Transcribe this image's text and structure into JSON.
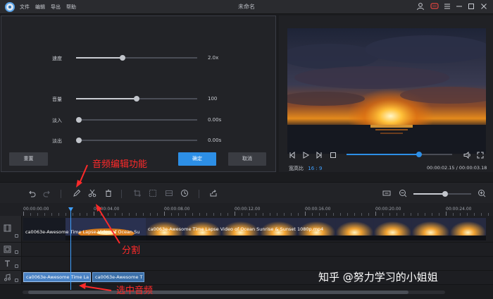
{
  "app": {
    "window_title": "未命名",
    "menu": [
      "文件",
      "编辑",
      "导出",
      "帮助"
    ]
  },
  "editor": {
    "rows": [
      {
        "label": "速度",
        "value": "2.0x",
        "level": 0.38
      },
      {
        "label": "音量",
        "value": "100",
        "level": 0.5
      },
      {
        "label": "淡入",
        "value": "0.00s",
        "level": 0
      },
      {
        "label": "淡出",
        "value": "0.00s",
        "level": 0
      }
    ],
    "reset_label": "重置",
    "confirm_label": "确定",
    "cancel_label": "取消"
  },
  "preview": {
    "aspect_label": "宽高比",
    "aspect_value": "16 : 9",
    "time": "00:00:02.15 / 00:00:03.18",
    "progress": 0.69
  },
  "timeline": {
    "ruler": [
      "00:00:00.00",
      "00:00:04.00",
      "00:00:08.00",
      "00:00:12.00",
      "00:00:16.00",
      "00:00:20.00",
      "00:00:24.00"
    ],
    "video_clip_1": "ca0063e-Awesome Time Lapse Video of Ocean Su",
    "video_clip_2": "ca0063e-Awesome Time Lapse Video of Ocean Sunrise & Sunset 1080p.mp4",
    "audio_clip_1": "ca0063e-Awesome Time La",
    "audio_clip_2": "ca0063e-Awesome T",
    "zoom_level": 0.55
  },
  "annotations": {
    "audio_edit": "音频编辑功能",
    "split": "分割",
    "select_audio": "选中音频"
  },
  "watermark": "知乎 @努力学习的小姐姐",
  "colors": {
    "accent": "#2d8fe6",
    "annotation": "#ff2a2a"
  }
}
